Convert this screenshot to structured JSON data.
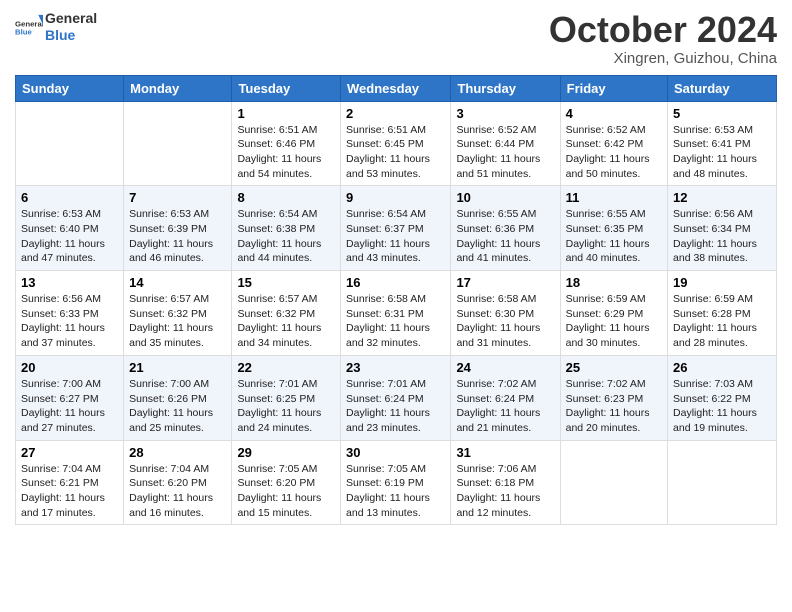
{
  "logo": {
    "general": "General",
    "blue": "Blue"
  },
  "header": {
    "month": "October 2024",
    "location": "Xingren, Guizhou, China"
  },
  "weekdays": [
    "Sunday",
    "Monday",
    "Tuesday",
    "Wednesday",
    "Thursday",
    "Friday",
    "Saturday"
  ],
  "weeks": [
    [
      {
        "day": "",
        "sunrise": "",
        "sunset": "",
        "daylight": ""
      },
      {
        "day": "",
        "sunrise": "",
        "sunset": "",
        "daylight": ""
      },
      {
        "day": "1",
        "sunrise": "Sunrise: 6:51 AM",
        "sunset": "Sunset: 6:46 PM",
        "daylight": "Daylight: 11 hours and 54 minutes."
      },
      {
        "day": "2",
        "sunrise": "Sunrise: 6:51 AM",
        "sunset": "Sunset: 6:45 PM",
        "daylight": "Daylight: 11 hours and 53 minutes."
      },
      {
        "day": "3",
        "sunrise": "Sunrise: 6:52 AM",
        "sunset": "Sunset: 6:44 PM",
        "daylight": "Daylight: 11 hours and 51 minutes."
      },
      {
        "day": "4",
        "sunrise": "Sunrise: 6:52 AM",
        "sunset": "Sunset: 6:42 PM",
        "daylight": "Daylight: 11 hours and 50 minutes."
      },
      {
        "day": "5",
        "sunrise": "Sunrise: 6:53 AM",
        "sunset": "Sunset: 6:41 PM",
        "daylight": "Daylight: 11 hours and 48 minutes."
      }
    ],
    [
      {
        "day": "6",
        "sunrise": "Sunrise: 6:53 AM",
        "sunset": "Sunset: 6:40 PM",
        "daylight": "Daylight: 11 hours and 47 minutes."
      },
      {
        "day": "7",
        "sunrise": "Sunrise: 6:53 AM",
        "sunset": "Sunset: 6:39 PM",
        "daylight": "Daylight: 11 hours and 46 minutes."
      },
      {
        "day": "8",
        "sunrise": "Sunrise: 6:54 AM",
        "sunset": "Sunset: 6:38 PM",
        "daylight": "Daylight: 11 hours and 44 minutes."
      },
      {
        "day": "9",
        "sunrise": "Sunrise: 6:54 AM",
        "sunset": "Sunset: 6:37 PM",
        "daylight": "Daylight: 11 hours and 43 minutes."
      },
      {
        "day": "10",
        "sunrise": "Sunrise: 6:55 AM",
        "sunset": "Sunset: 6:36 PM",
        "daylight": "Daylight: 11 hours and 41 minutes."
      },
      {
        "day": "11",
        "sunrise": "Sunrise: 6:55 AM",
        "sunset": "Sunset: 6:35 PM",
        "daylight": "Daylight: 11 hours and 40 minutes."
      },
      {
        "day": "12",
        "sunrise": "Sunrise: 6:56 AM",
        "sunset": "Sunset: 6:34 PM",
        "daylight": "Daylight: 11 hours and 38 minutes."
      }
    ],
    [
      {
        "day": "13",
        "sunrise": "Sunrise: 6:56 AM",
        "sunset": "Sunset: 6:33 PM",
        "daylight": "Daylight: 11 hours and 37 minutes."
      },
      {
        "day": "14",
        "sunrise": "Sunrise: 6:57 AM",
        "sunset": "Sunset: 6:32 PM",
        "daylight": "Daylight: 11 hours and 35 minutes."
      },
      {
        "day": "15",
        "sunrise": "Sunrise: 6:57 AM",
        "sunset": "Sunset: 6:32 PM",
        "daylight": "Daylight: 11 hours and 34 minutes."
      },
      {
        "day": "16",
        "sunrise": "Sunrise: 6:58 AM",
        "sunset": "Sunset: 6:31 PM",
        "daylight": "Daylight: 11 hours and 32 minutes."
      },
      {
        "day": "17",
        "sunrise": "Sunrise: 6:58 AM",
        "sunset": "Sunset: 6:30 PM",
        "daylight": "Daylight: 11 hours and 31 minutes."
      },
      {
        "day": "18",
        "sunrise": "Sunrise: 6:59 AM",
        "sunset": "Sunset: 6:29 PM",
        "daylight": "Daylight: 11 hours and 30 minutes."
      },
      {
        "day": "19",
        "sunrise": "Sunrise: 6:59 AM",
        "sunset": "Sunset: 6:28 PM",
        "daylight": "Daylight: 11 hours and 28 minutes."
      }
    ],
    [
      {
        "day": "20",
        "sunrise": "Sunrise: 7:00 AM",
        "sunset": "Sunset: 6:27 PM",
        "daylight": "Daylight: 11 hours and 27 minutes."
      },
      {
        "day": "21",
        "sunrise": "Sunrise: 7:00 AM",
        "sunset": "Sunset: 6:26 PM",
        "daylight": "Daylight: 11 hours and 25 minutes."
      },
      {
        "day": "22",
        "sunrise": "Sunrise: 7:01 AM",
        "sunset": "Sunset: 6:25 PM",
        "daylight": "Daylight: 11 hours and 24 minutes."
      },
      {
        "day": "23",
        "sunrise": "Sunrise: 7:01 AM",
        "sunset": "Sunset: 6:24 PM",
        "daylight": "Daylight: 11 hours and 23 minutes."
      },
      {
        "day": "24",
        "sunrise": "Sunrise: 7:02 AM",
        "sunset": "Sunset: 6:24 PM",
        "daylight": "Daylight: 11 hours and 21 minutes."
      },
      {
        "day": "25",
        "sunrise": "Sunrise: 7:02 AM",
        "sunset": "Sunset: 6:23 PM",
        "daylight": "Daylight: 11 hours and 20 minutes."
      },
      {
        "day": "26",
        "sunrise": "Sunrise: 7:03 AM",
        "sunset": "Sunset: 6:22 PM",
        "daylight": "Daylight: 11 hours and 19 minutes."
      }
    ],
    [
      {
        "day": "27",
        "sunrise": "Sunrise: 7:04 AM",
        "sunset": "Sunset: 6:21 PM",
        "daylight": "Daylight: 11 hours and 17 minutes."
      },
      {
        "day": "28",
        "sunrise": "Sunrise: 7:04 AM",
        "sunset": "Sunset: 6:20 PM",
        "daylight": "Daylight: 11 hours and 16 minutes."
      },
      {
        "day": "29",
        "sunrise": "Sunrise: 7:05 AM",
        "sunset": "Sunset: 6:20 PM",
        "daylight": "Daylight: 11 hours and 15 minutes."
      },
      {
        "day": "30",
        "sunrise": "Sunrise: 7:05 AM",
        "sunset": "Sunset: 6:19 PM",
        "daylight": "Daylight: 11 hours and 13 minutes."
      },
      {
        "day": "31",
        "sunrise": "Sunrise: 7:06 AM",
        "sunset": "Sunset: 6:18 PM",
        "daylight": "Daylight: 11 hours and 12 minutes."
      },
      {
        "day": "",
        "sunrise": "",
        "sunset": "",
        "daylight": ""
      },
      {
        "day": "",
        "sunrise": "",
        "sunset": "",
        "daylight": ""
      }
    ]
  ]
}
